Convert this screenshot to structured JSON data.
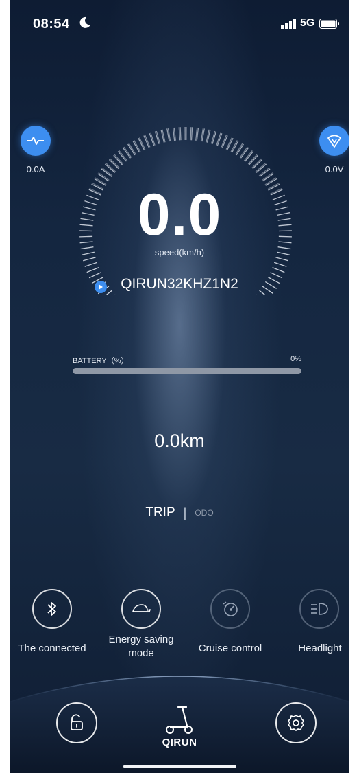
{
  "status_bar": {
    "time": "08:54",
    "network": "5G",
    "icons": [
      "moon-icon",
      "signal-icon",
      "battery-icon"
    ]
  },
  "meters": {
    "current": {
      "value": "0.0A",
      "icon": "pulse-icon"
    },
    "voltage": {
      "value": "0.0V",
      "icon": "voltage-icon"
    }
  },
  "speed": {
    "value": "0.0",
    "unit": "speed(km/h)",
    "device_name": "QIRUN32KHZ1N2"
  },
  "battery": {
    "label": "BATTERY（%）",
    "percent_text": "0%",
    "level": 0
  },
  "distance": {
    "value": "0.0km",
    "tabs": {
      "trip": "TRIP",
      "separator": "|",
      "odo": "ODO"
    },
    "active_tab": "trip"
  },
  "functions": [
    {
      "label": "The connected",
      "icon": "bluetooth-icon",
      "active": true
    },
    {
      "label": "Energy saving mode",
      "icon": "turtle-icon",
      "active": true
    },
    {
      "label": "Cruise control",
      "icon": "cruise-control-icon",
      "active": false
    },
    {
      "label": "Headlight",
      "icon": "headlight-icon",
      "active": false
    }
  ],
  "nav": {
    "unlock_icon": "unlock-icon",
    "home_icon": "scooter-icon",
    "logo": "QIRUN",
    "settings_icon": "gear-icon"
  },
  "colors": {
    "accent": "#3d8ef0",
    "background": "#142640"
  }
}
